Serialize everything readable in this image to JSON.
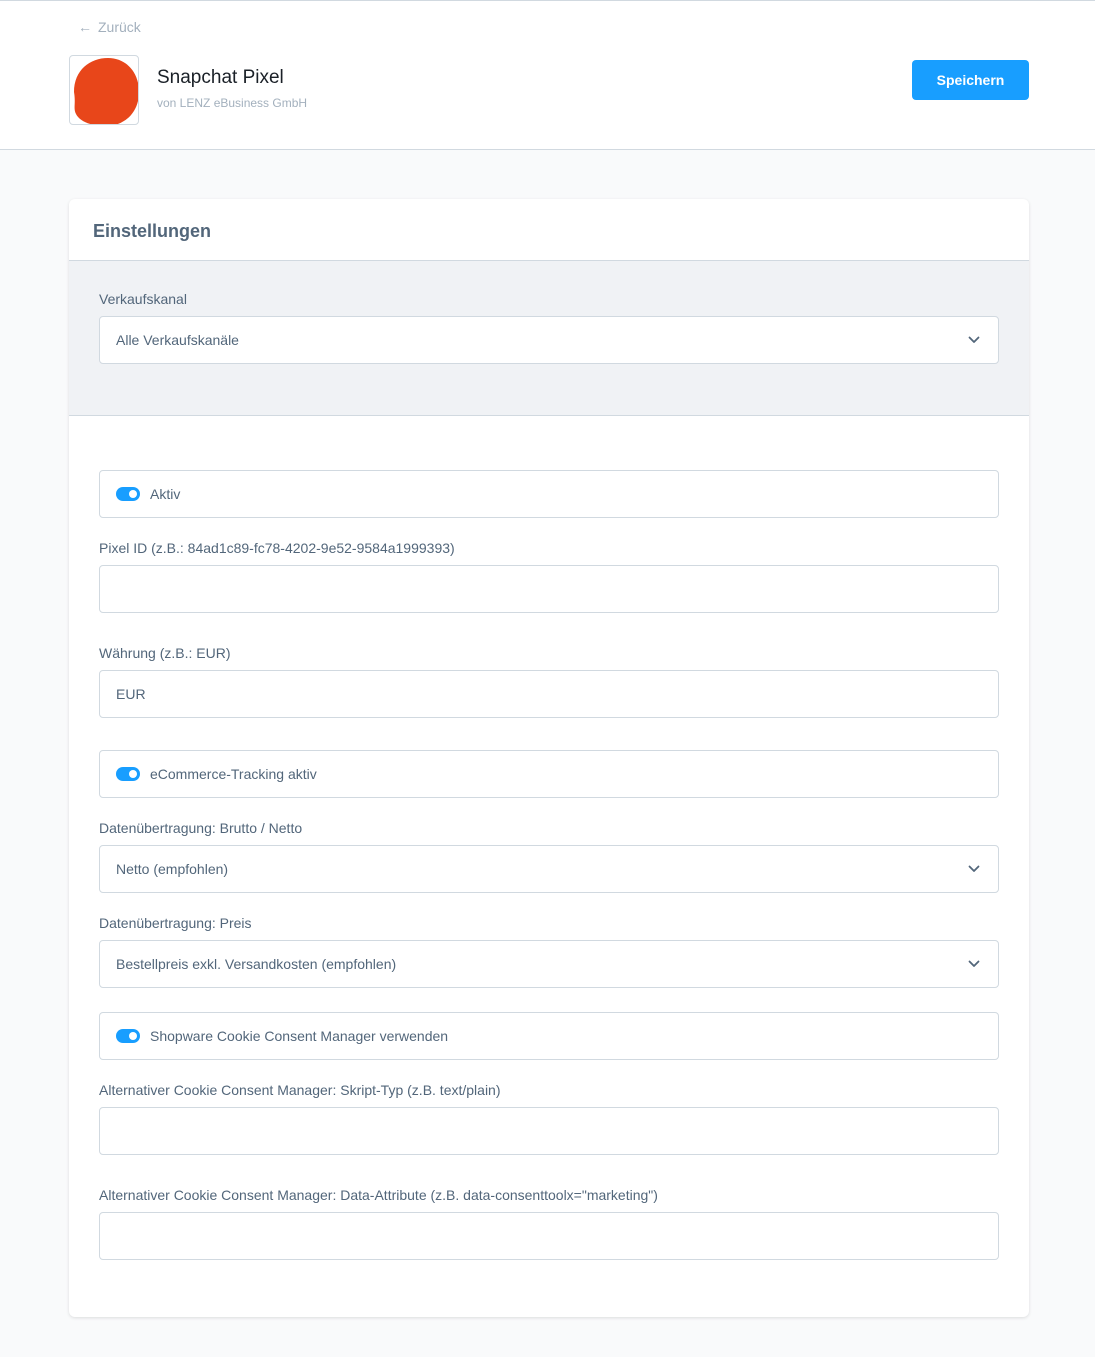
{
  "header": {
    "back_label": "Zurück",
    "app_name": "Snapchat Pixel",
    "vendor": "von LENZ eBusiness GmbH",
    "save_label": "Speichern",
    "logo_color": "#e8461a",
    "accent_color": "#189eff"
  },
  "card": {
    "title": "Einstellungen",
    "sales_channel": {
      "label": "Verkaufskanal",
      "value": "Alle Verkaufskanäle"
    },
    "fields": {
      "active": {
        "label": "Aktiv",
        "checked": true
      },
      "pixel_id": {
        "label": "Pixel ID (z.B.: 84ad1c89-fc78-4202-9e52-9584a1999393)",
        "value": ""
      },
      "currency": {
        "label": "Währung (z.B.: EUR)",
        "value": "EUR"
      },
      "ecommerce_tracking": {
        "label": "eCommerce-Tracking aktiv",
        "checked": true
      },
      "gross_net": {
        "label": "Datenübertragung: Brutto / Netto",
        "value": "Netto (empfohlen)"
      },
      "price": {
        "label": "Datenübertragung: Preis",
        "value": "Bestellpreis exkl. Versandkosten (empfohlen)"
      },
      "cookie_consent": {
        "label": "Shopware Cookie Consent Manager verwenden",
        "checked": true
      },
      "script_type": {
        "label": "Alternativer Cookie Consent Manager: Skript-Typ (z.B. text/plain)",
        "value": ""
      },
      "data_attribute": {
        "label": "Alternativer Cookie Consent Manager: Data-Attribute (z.B. data-consenttoolx=\"marketing\")",
        "value": ""
      }
    }
  }
}
